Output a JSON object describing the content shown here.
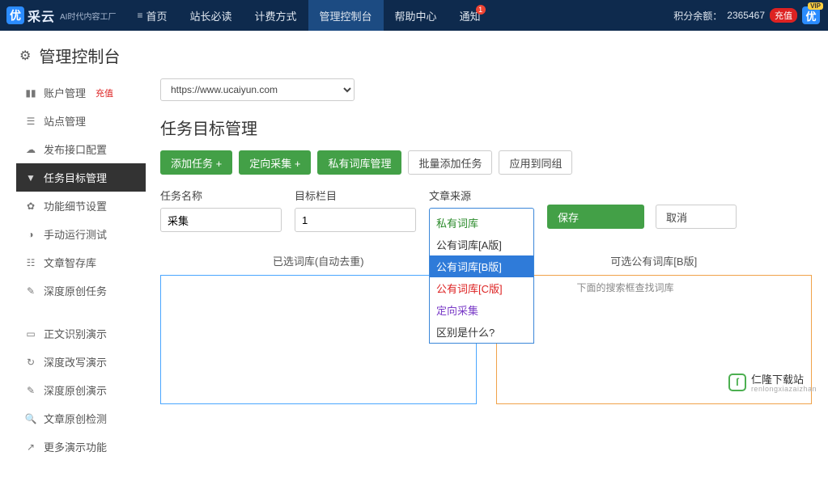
{
  "topbar": {
    "logo_text": "采云",
    "logo_sub": "AI时代内容工厂",
    "nav": [
      {
        "label": "首页"
      },
      {
        "label": "站长必读"
      },
      {
        "label": "计费方式"
      },
      {
        "label": "管理控制台",
        "active": true
      },
      {
        "label": "帮助中心"
      },
      {
        "label": "通知",
        "badge": "1"
      }
    ],
    "points_label": "积分余额：",
    "points_value": "2365467",
    "charge": "充值"
  },
  "page_title": "管理控制台",
  "sidebar": {
    "group1": [
      {
        "label": "账户管理",
        "charge": "充值"
      },
      {
        "label": "站点管理"
      },
      {
        "label": "发布接口配置"
      },
      {
        "label": "任务目标管理",
        "active": true
      },
      {
        "label": "功能细节设置"
      },
      {
        "label": "手动运行测试"
      },
      {
        "label": "文章智存库"
      },
      {
        "label": "深度原创任务"
      }
    ],
    "group2": [
      {
        "label": "正文识别演示"
      },
      {
        "label": "深度改写演示"
      },
      {
        "label": "深度原创演示"
      },
      {
        "label": "文章原创检测"
      },
      {
        "label": "更多演示功能"
      }
    ]
  },
  "main": {
    "url_select": "https://www.ucaiyun.com",
    "section_title": "任务目标管理",
    "toolbar": {
      "add_task": "添加任务 +",
      "targeted": "定向采集 +",
      "private_lib": "私有词库管理",
      "batch_add": "批量添加任务",
      "apply_group": "应用到同组"
    },
    "form": {
      "name_label": "任务名称",
      "name_value": "采集",
      "target_label": "目标栏目",
      "target_value": "1",
      "source_label": "文章来源",
      "source_value": "公有词库[B版]",
      "dropdown": [
        {
          "label": "私有词库",
          "cls": "di-private"
        },
        {
          "label": "公有词库[A版]"
        },
        {
          "label": "公有词库[B版]",
          "selected": true
        },
        {
          "label": "公有词库[C版]",
          "cls": "di-c"
        },
        {
          "label": "定向采集",
          "cls": "di-targeted"
        },
        {
          "label": "区别是什么?"
        }
      ],
      "save": "保存",
      "cancel": "取消"
    },
    "panels": {
      "left_title": "已选词库(自动去重)",
      "right_title": "可选公有词库[B版]",
      "hint": "下面的搜索框查找词库"
    }
  },
  "watermark": {
    "name": "仁隆下载站",
    "sub": "renlongxiazaizhan"
  }
}
